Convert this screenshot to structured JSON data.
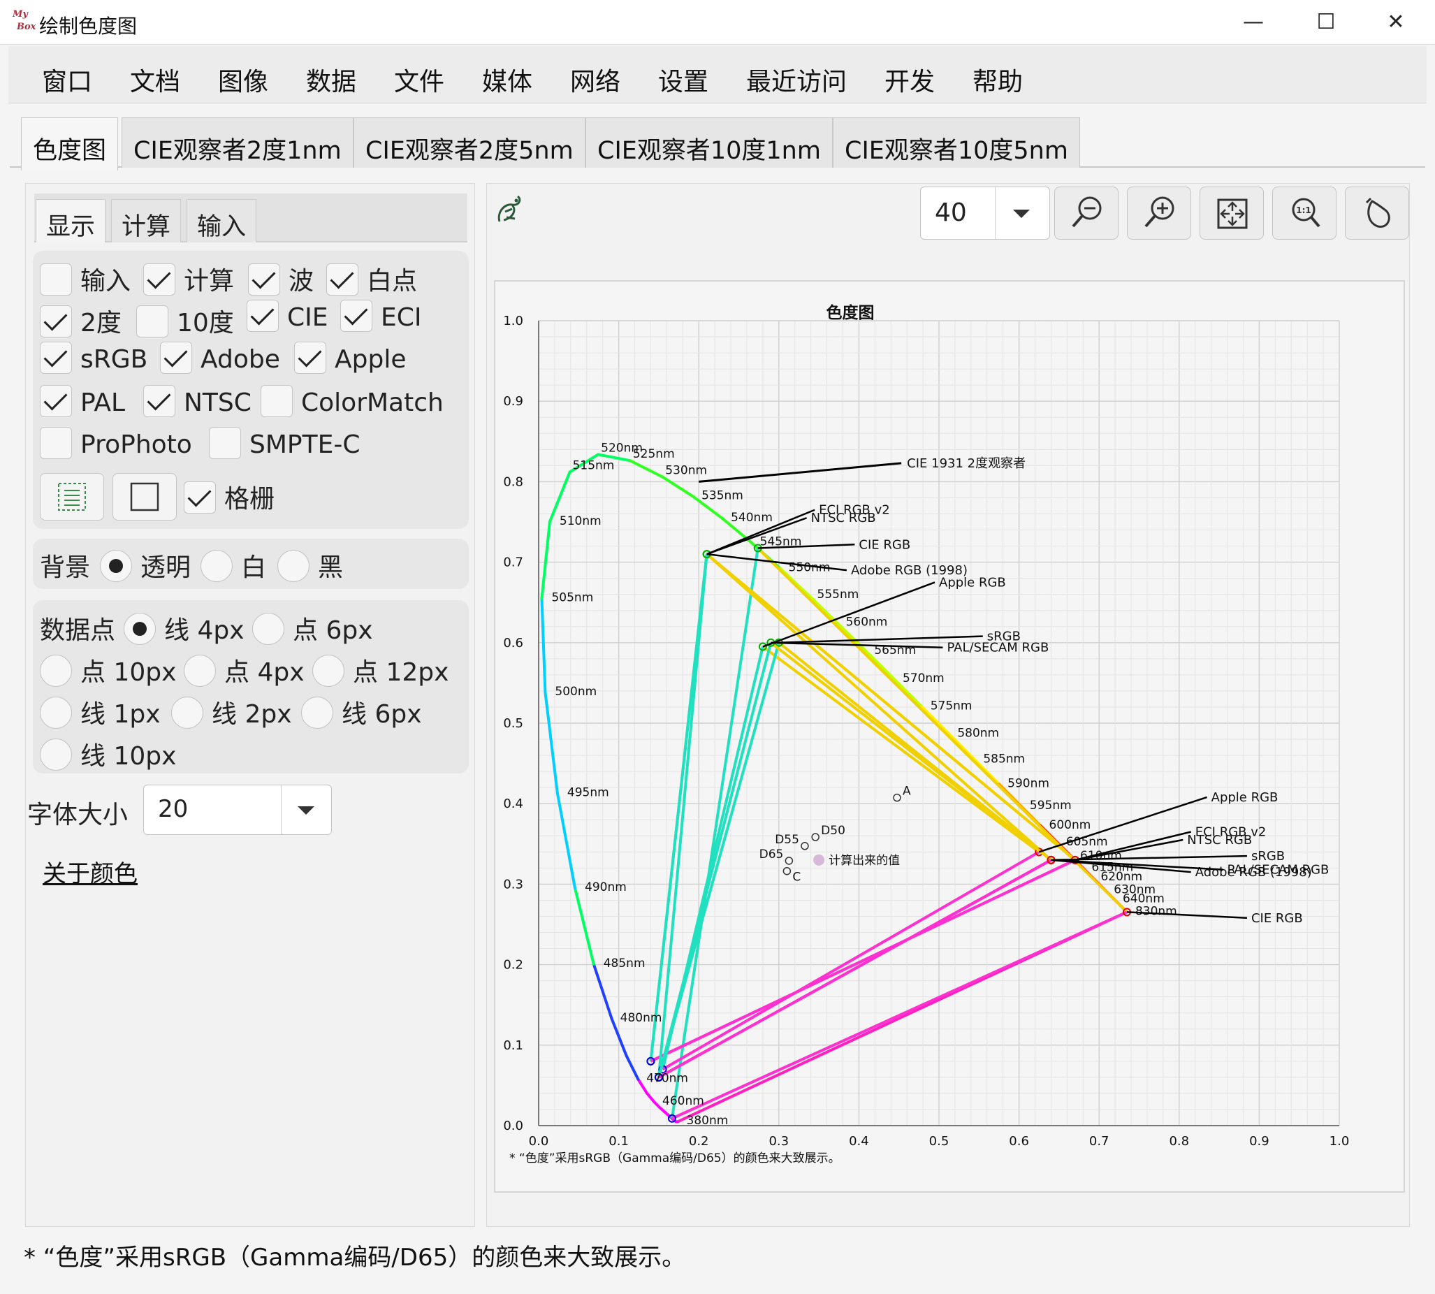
{
  "window": {
    "logo_line1": "My",
    "logo_line2": "Box",
    "title": "绘制色度图"
  },
  "menu": [
    "窗口",
    "文档",
    "图像",
    "数据",
    "文件",
    "媒体",
    "网络",
    "设置",
    "最近访问",
    "开发",
    "帮助"
  ],
  "main_tabs": [
    "色度图",
    "CIE观察者2度1nm",
    "CIE观察者2度5nm",
    "CIE观察者10度1nm",
    "CIE观察者10度5nm"
  ],
  "left": {
    "sub_tabs": [
      "显示",
      "计算",
      "输入"
    ],
    "checks": [
      {
        "label": "输入",
        "checked": false
      },
      {
        "label": "计算",
        "checked": true
      },
      {
        "label": "波",
        "checked": true
      },
      {
        "label": "白点",
        "checked": true
      },
      {
        "label": "2度",
        "checked": true
      },
      {
        "label": "10度",
        "checked": false
      },
      {
        "label": "CIE",
        "checked": true
      },
      {
        "label": "ECI",
        "checked": true
      },
      {
        "label": "sRGB",
        "checked": true
      },
      {
        "label": "Adobe",
        "checked": true
      },
      {
        "label": "Apple",
        "checked": true
      },
      {
        "label": "PAL",
        "checked": true
      },
      {
        "label": "NTSC",
        "checked": true
      },
      {
        "label": "ColorMatch",
        "checked": false
      },
      {
        "label": "ProPhoto",
        "checked": false
      },
      {
        "label": "SMPTE-C",
        "checked": false
      }
    ],
    "grid_check": {
      "label": "格栅",
      "checked": true
    },
    "background": {
      "label": "背景",
      "options": [
        "透明",
        "白",
        "黑"
      ],
      "selected": 0
    },
    "datapoints": {
      "label": "数据点",
      "options": [
        "线 4px",
        "点 6px",
        "点 10px",
        "点 4px",
        "点 12px",
        "线 1px",
        "线 2px",
        "线 6px",
        "线 10px"
      ],
      "selected": 0
    },
    "font_size": {
      "label": "字体大小",
      "value": "20"
    },
    "about_link": "关于颜色"
  },
  "toolbar": {
    "zoom_value": "40",
    "buttons": [
      "zoom-out",
      "zoom-in",
      "fit-window",
      "original-size",
      "pop"
    ]
  },
  "chart_data": {
    "type": "scatter",
    "title": "色度图",
    "size_label": "1500x1500",
    "xlim": [
      0.0,
      1.0
    ],
    "ylim": [
      0.0,
      1.0
    ],
    "x_ticks": [
      "0.0",
      "0.1",
      "0.2",
      "0.3",
      "0.4",
      "0.5",
      "0.6",
      "0.7",
      "0.8",
      "0.9",
      "1.0"
    ],
    "y_ticks": [
      "0.0",
      "0.1",
      "0.2",
      "0.3",
      "0.4",
      "0.5",
      "0.6",
      "0.7",
      "0.8",
      "0.9",
      "1.0"
    ],
    "grid": true,
    "footnote": "* “色度”采用sRGB（Gamma编码/D65）的颜色来大致展示。",
    "locus": [
      [
        0.1741,
        0.005
      ],
      [
        0.1738,
        0.0049
      ],
      [
        0.1736,
        0.0049
      ],
      [
        0.1733,
        0.0048
      ],
      [
        0.173,
        0.0048
      ],
      [
        0.1726,
        0.0048
      ],
      [
        0.1721,
        0.0048
      ],
      [
        0.1714,
        0.0051
      ],
      [
        0.1703,
        0.0058
      ],
      [
        0.1689,
        0.0069
      ],
      [
        0.1669,
        0.0086
      ],
      [
        0.1644,
        0.0109
      ],
      [
        0.1611,
        0.0138
      ],
      [
        0.1566,
        0.0177
      ],
      [
        0.151,
        0.0227
      ],
      [
        0.144,
        0.0297
      ],
      [
        0.1355,
        0.0399
      ],
      [
        0.1241,
        0.0578
      ],
      [
        0.1096,
        0.0868
      ],
      [
        0.0913,
        0.1327
      ],
      [
        0.0687,
        0.2007
      ],
      [
        0.0454,
        0.295
      ],
      [
        0.0235,
        0.4127
      ],
      [
        0.0082,
        0.5384
      ],
      [
        0.0039,
        0.6548
      ],
      [
        0.0139,
        0.7502
      ],
      [
        0.0389,
        0.812
      ],
      [
        0.0743,
        0.8338
      ],
      [
        0.1142,
        0.8262
      ],
      [
        0.1547,
        0.8059
      ],
      [
        0.1929,
        0.7816
      ],
      [
        0.2296,
        0.7543
      ],
      [
        0.2658,
        0.7243
      ],
      [
        0.3016,
        0.6923
      ],
      [
        0.3373,
        0.6589
      ],
      [
        0.3731,
        0.6245
      ],
      [
        0.4087,
        0.5896
      ],
      [
        0.4441,
        0.5547
      ],
      [
        0.4788,
        0.5202
      ],
      [
        0.5125,
        0.4866
      ],
      [
        0.5448,
        0.4544
      ],
      [
        0.5752,
        0.4242
      ],
      [
        0.6029,
        0.3965
      ],
      [
        0.627,
        0.3725
      ],
      [
        0.6482,
        0.3514
      ],
      [
        0.6658,
        0.334
      ],
      [
        0.6801,
        0.3197
      ],
      [
        0.6915,
        0.3083
      ],
      [
        0.7006,
        0.2993
      ],
      [
        0.7079,
        0.292
      ],
      [
        0.714,
        0.2859
      ],
      [
        0.719,
        0.2809
      ],
      [
        0.723,
        0.277
      ],
      [
        0.726,
        0.274
      ],
      [
        0.7283,
        0.2717
      ],
      [
        0.73,
        0.27
      ],
      [
        0.7311,
        0.2689
      ],
      [
        0.732,
        0.268
      ],
      [
        0.7327,
        0.2673
      ],
      [
        0.7334,
        0.2666
      ],
      [
        0.734,
        0.266
      ],
      [
        0.7344,
        0.2656
      ],
      [
        0.7346,
        0.2654
      ],
      [
        0.7347,
        0.2653
      ]
    ],
    "wavelength_labels": [
      {
        "text": "380nm",
        "x": 0.1741,
        "y": 0.005
      },
      {
        "text": "460nm",
        "x": 0.144,
        "y": 0.0297
      },
      {
        "text": "470nm",
        "x": 0.1241,
        "y": 0.0578
      },
      {
        "text": "480nm",
        "x": 0.0913,
        "y": 0.1327
      },
      {
        "text": "485nm",
        "x": 0.0687,
        "y": 0.2007
      },
      {
        "text": "490nm",
        "x": 0.0454,
        "y": 0.295
      },
      {
        "text": "495nm",
        "x": 0.0235,
        "y": 0.4127
      },
      {
        "text": "500nm",
        "x": 0.0082,
        "y": 0.5384
      },
      {
        "text": "505nm",
        "x": 0.0039,
        "y": 0.6548
      },
      {
        "text": "510nm",
        "x": 0.0139,
        "y": 0.7502
      },
      {
        "text": "515nm",
        "x": 0.0389,
        "y": 0.812
      },
      {
        "text": "520nm",
        "x": 0.0743,
        "y": 0.8338
      },
      {
        "text": "525nm",
        "x": 0.1142,
        "y": 0.8262
      },
      {
        "text": "530nm",
        "x": 0.1547,
        "y": 0.8059
      },
      {
        "text": "535nm",
        "x": 0.1929,
        "y": 0.7816
      },
      {
        "text": "540nm",
        "x": 0.2296,
        "y": 0.7543
      },
      {
        "text": "545nm",
        "x": 0.2658,
        "y": 0.7243
      },
      {
        "text": "550nm",
        "x": 0.3016,
        "y": 0.6923
      },
      {
        "text": "555nm",
        "x": 0.3373,
        "y": 0.6589
      },
      {
        "text": "560nm",
        "x": 0.3731,
        "y": 0.6245
      },
      {
        "text": "565nm",
        "x": 0.4087,
        "y": 0.5896
      },
      {
        "text": "570nm",
        "x": 0.4441,
        "y": 0.5547
      },
      {
        "text": "575nm",
        "x": 0.4788,
        "y": 0.5202
      },
      {
        "text": "580nm",
        "x": 0.5125,
        "y": 0.4866
      },
      {
        "text": "585nm",
        "x": 0.5448,
        "y": 0.4544
      },
      {
        "text": "590nm",
        "x": 0.5752,
        "y": 0.4242
      },
      {
        "text": "595nm",
        "x": 0.6029,
        "y": 0.3965
      },
      {
        "text": "600nm",
        "x": 0.627,
        "y": 0.3725
      },
      {
        "text": "605nm",
        "x": 0.6482,
        "y": 0.3514
      },
      {
        "text": "610nm",
        "x": 0.6658,
        "y": 0.334
      },
      {
        "text": "615nm",
        "x": 0.6801,
        "y": 0.3197
      },
      {
        "text": "620nm",
        "x": 0.6915,
        "y": 0.3083
      },
      {
        "text": "630nm",
        "x": 0.7079,
        "y": 0.292
      },
      {
        "text": "640nm",
        "x": 0.719,
        "y": 0.2809
      },
      {
        "text": "830nm",
        "x": 0.7347,
        "y": 0.2653
      }
    ],
    "gamuts": [
      {
        "name": "CIE 1931 2度观察者",
        "label_at": [
          0.46,
          0.823
        ]
      },
      {
        "name": "CIE RGB",
        "r": [
          0.7347,
          0.2653
        ],
        "g": [
          0.2738,
          0.7174
        ],
        "b": [
          0.1666,
          0.0089
        ],
        "gl": [
          0.4,
          0.722
        ],
        "rl": [
          0.89,
          0.258
        ]
      },
      {
        "name": "ECI RGB v2",
        "r": [
          0.67,
          0.33
        ],
        "g": [
          0.21,
          0.71
        ],
        "b": [
          0.14,
          0.08
        ],
        "gl": [
          0.35,
          0.765
        ],
        "rl": [
          0.82,
          0.365
        ]
      },
      {
        "name": "NTSC RGB",
        "r": [
          0.67,
          0.33
        ],
        "g": [
          0.21,
          0.71
        ],
        "b": [
          0.14,
          0.08
        ],
        "gl": [
          0.34,
          0.755
        ],
        "rl": [
          0.81,
          0.355
        ]
      },
      {
        "name": "Adobe RGB (1998)",
        "r": [
          0.64,
          0.33
        ],
        "g": [
          0.21,
          0.71
        ],
        "b": [
          0.15,
          0.06
        ],
        "gl": [
          0.39,
          0.69
        ],
        "rl": [
          0.82,
          0.315
        ]
      },
      {
        "name": "Apple RGB",
        "r": [
          0.625,
          0.34
        ],
        "g": [
          0.28,
          0.595
        ],
        "b": [
          0.155,
          0.07
        ],
        "gl": [
          0.5,
          0.675
        ],
        "rl": [
          0.84,
          0.408
        ]
      },
      {
        "name": "sRGB",
        "r": [
          0.64,
          0.33
        ],
        "g": [
          0.3,
          0.6
        ],
        "b": [
          0.15,
          0.06
        ],
        "gl": [
          0.56,
          0.608
        ],
        "rl": [
          0.89,
          0.335
        ]
      },
      {
        "name": "PAL/SECAM RGB",
        "r": [
          0.64,
          0.33
        ],
        "g": [
          0.29,
          0.6
        ],
        "b": [
          0.15,
          0.06
        ],
        "gl": [
          0.51,
          0.594
        ],
        "rl": [
          0.86,
          0.318
        ]
      }
    ],
    "white_points": [
      {
        "name": "A",
        "x": 0.4476,
        "y": 0.4074
      },
      {
        "name": "D50",
        "x": 0.3457,
        "y": 0.3585
      },
      {
        "name": "D55",
        "x": 0.3324,
        "y": 0.3474
      },
      {
        "name": "D65",
        "x": 0.3127,
        "y": 0.329
      },
      {
        "name": "C",
        "x": 0.3101,
        "y": 0.3162
      }
    ],
    "calculated": {
      "name": "计算出来的值",
      "x": 0.35,
      "y": 0.33
    }
  }
}
